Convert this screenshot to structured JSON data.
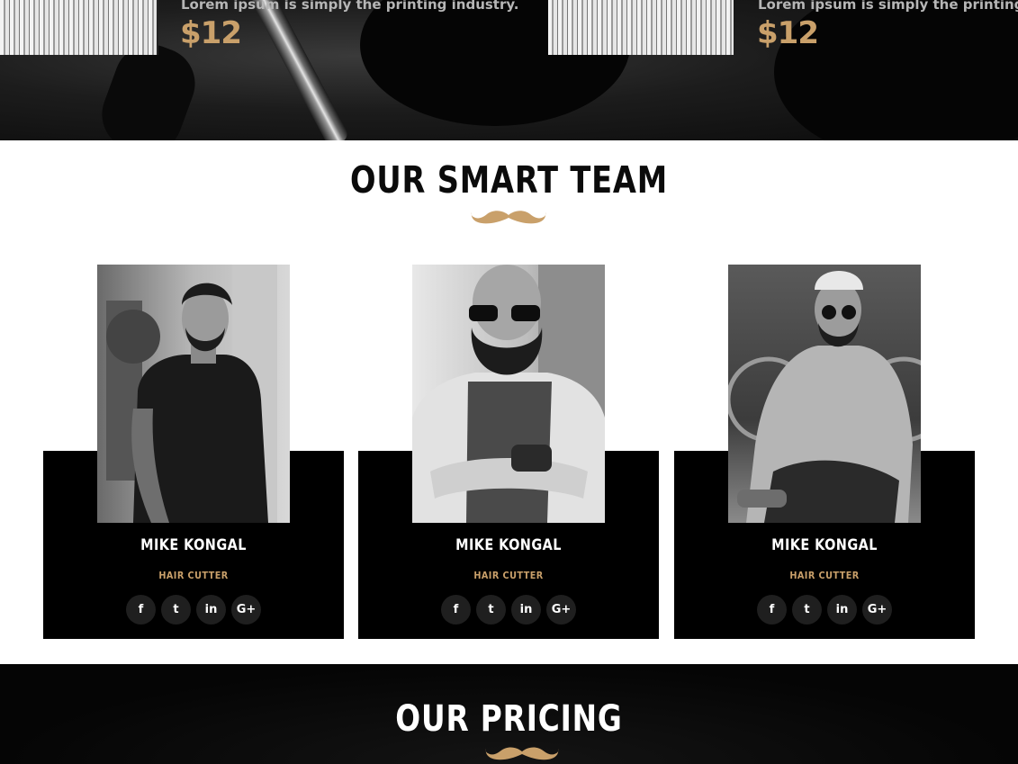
{
  "menu_items": [
    {
      "description": "Lorem ipsum is simply the printing industry.",
      "price": "$12"
    },
    {
      "description": "Lorem ipsum is simply the printing inc",
      "price": "$12"
    }
  ],
  "team_section": {
    "title": "OUR SMART TEAM",
    "members": [
      {
        "name": "MIKE KONGAL",
        "role": "HAIR CUTTER"
      },
      {
        "name": "MIKE KONGAL",
        "role": "HAIR CUTTER"
      },
      {
        "name": "MIKE KONGAL",
        "role": "HAIR CUTTER"
      }
    ],
    "social_icons": [
      "facebook-icon",
      "twitter-icon",
      "linkedin-icon",
      "google-plus-icon"
    ],
    "social_glyphs": {
      "facebook": "f",
      "twitter": "t",
      "linkedin": "in",
      "google_plus": "G+"
    }
  },
  "pricing_section": {
    "title": "OUR PRICING"
  },
  "colors": {
    "accent": "#c9a06a",
    "card": "#000000",
    "social_button": "#1f1f1f",
    "heading_dark": "#0b0b0b"
  }
}
